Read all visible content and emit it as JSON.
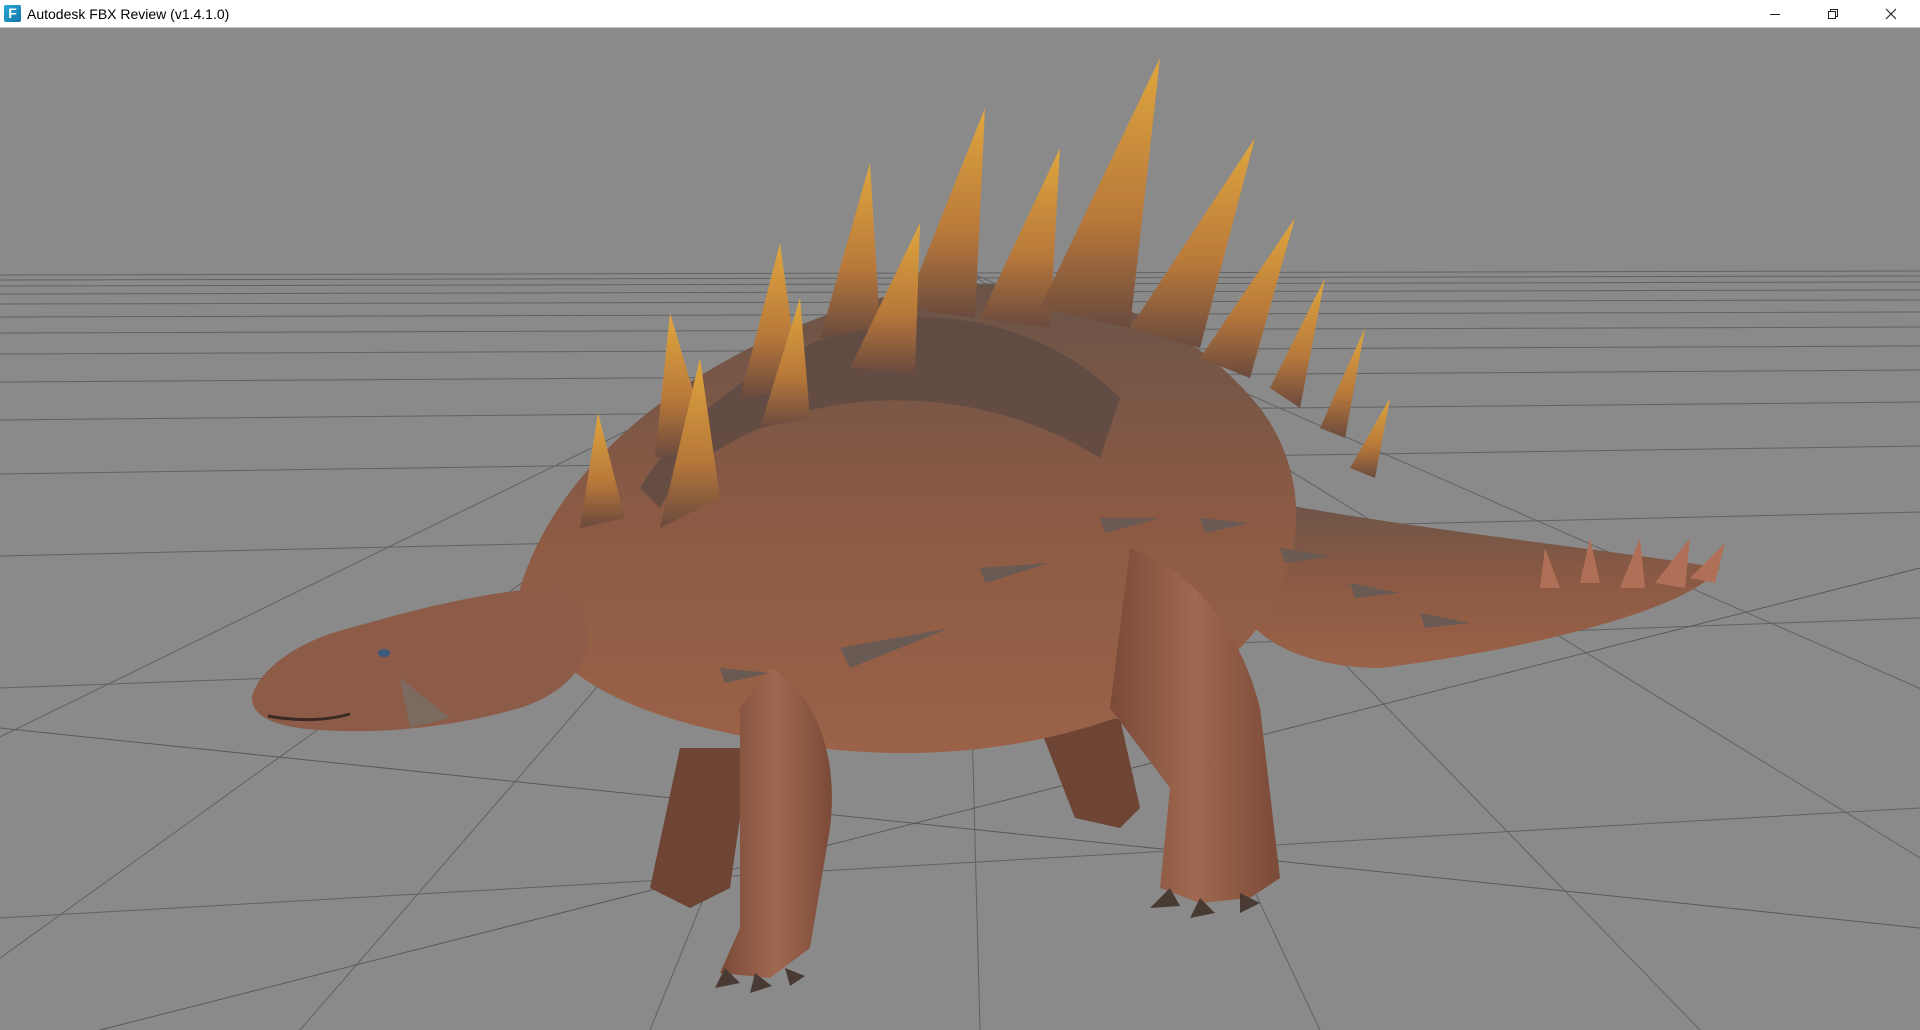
{
  "window": {
    "title": "Autodesk FBX Review (v1.4.1.0)",
    "app_icon_letter": "F",
    "controls": {
      "minimize": "minimize-icon",
      "restore": "restore-icon",
      "close": "close-icon"
    }
  },
  "viewport": {
    "background_color": "#8a8a8a",
    "grid_color": "#5e5e5e",
    "model": "stegosaur-model",
    "model_colors": {
      "body": "#8c5a44",
      "dark_plates": "#5a4a40",
      "spike_tip": "#d89a3a",
      "spike_base": "#a0603a"
    }
  }
}
